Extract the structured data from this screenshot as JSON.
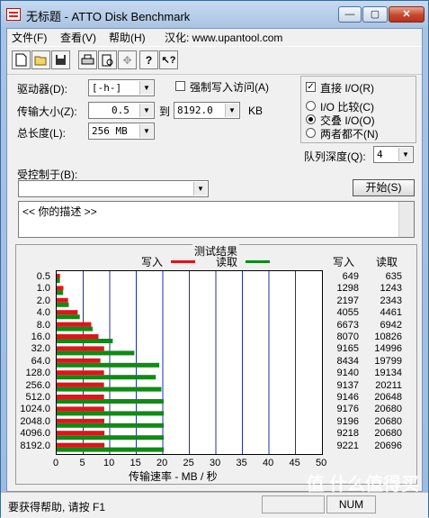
{
  "window": {
    "title": "无标题 - ATTO Disk Benchmark",
    "min": "—",
    "max": "▢",
    "close": "✕"
  },
  "menu": {
    "file": "文件(F)",
    "view": "查看(V)",
    "help": "帮助(H)",
    "localized": "汉化: www.upantool.com"
  },
  "toolbar": {
    "icons": [
      "new-icon",
      "open-icon",
      "save-icon",
      "print-icon",
      "print-preview-icon",
      "move-icon",
      "help-icon",
      "context-help-icon"
    ]
  },
  "settings": {
    "drive_label": "驱动器(D):",
    "drive_value": "[-h-]",
    "force_write_label": "强制写入访问(A)",
    "transfer_label": "传输大小(Z):",
    "transfer_from": "0.5",
    "to_label": "到",
    "transfer_to": "8192.0",
    "kb_label": "KB",
    "length_label": "总长度(L):",
    "length_value": "256 MB",
    "direct_io_label": "直接 I/O(R)",
    "io_compare_label": "I/O 比较(C)",
    "overlap_io_label": "交叠 I/O(O)",
    "neither_label": "两者都不(N)",
    "queue_label": "队列深度(Q):",
    "queue_value": "4",
    "controlled_label": "受控制于(B):",
    "start_button": "开始(S)",
    "description": "<<   你的描述    >>"
  },
  "results": {
    "group_title": "测试结果",
    "write_label": "写入",
    "read_label": "读取",
    "write_color": "#e0141a",
    "read_color": "#108a14",
    "col_write": "写入",
    "col_read": "读取",
    "xaxis_label": "传输速率 - MB / 秒"
  },
  "chart_data": {
    "type": "bar",
    "orientation": "horizontal",
    "categories": [
      "0.5",
      "1.0",
      "2.0",
      "4.0",
      "8.0",
      "16.0",
      "32.0",
      "64.0",
      "128.0",
      "256.0",
      "512.0",
      "1024.0",
      "2048.0",
      "4096.0",
      "8192.0"
    ],
    "series": [
      {
        "name": "写入",
        "values": [
          649,
          1298,
          2197,
          4055,
          6673,
          8070,
          9165,
          8434,
          9140,
          9137,
          9146,
          9176,
          9196,
          9218,
          9221
        ]
      },
      {
        "name": "读取",
        "values": [
          635,
          1243,
          2343,
          4461,
          6942,
          10826,
          14996,
          19799,
          19134,
          20211,
          20648,
          20680,
          20680,
          20680,
          20696
        ]
      }
    ],
    "xticks": [
      "0",
      "5",
      "10",
      "15",
      "20",
      "25",
      "30",
      "35",
      "40",
      "45",
      "50"
    ],
    "xlim": [
      0,
      50
    ],
    "xlabel": "传输速率 - MB / 秒",
    "grid": "vertical"
  },
  "status": {
    "help_text": "要获得帮助, 请按 F1",
    "num": "NUM"
  },
  "watermark": "值 什么值得买"
}
